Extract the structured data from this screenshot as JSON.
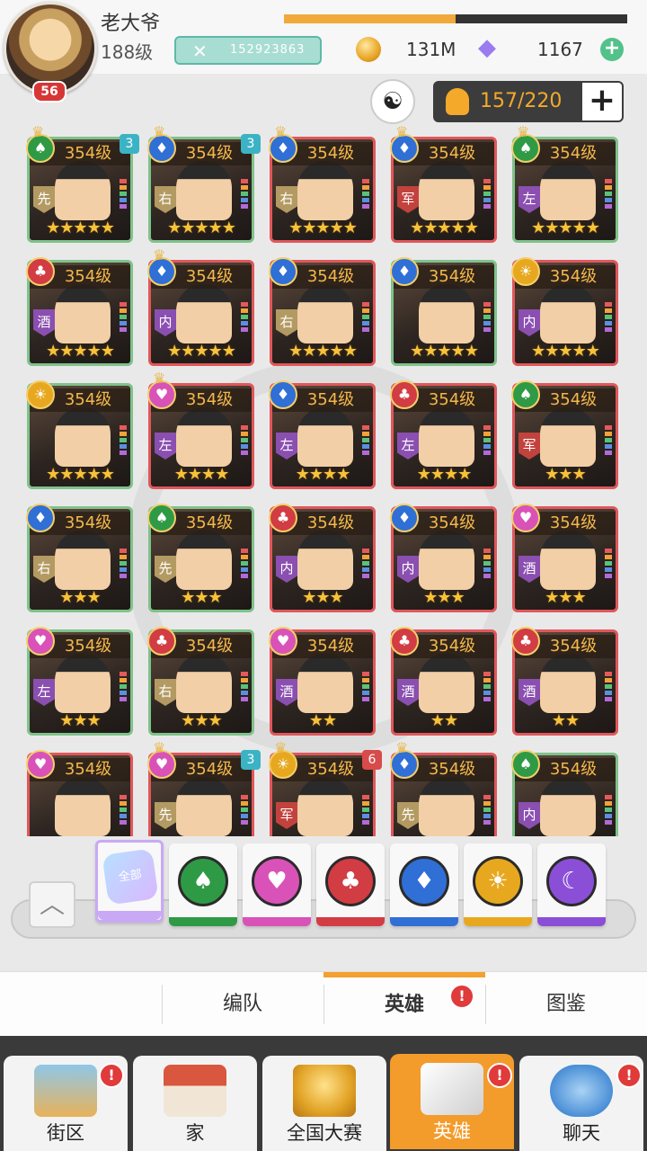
{
  "player": {
    "name": "老大爷",
    "level": "188级",
    "avatar_level": "56",
    "power": "152923863",
    "exp_progress": 0.5,
    "coins": "131M",
    "gems": "1167"
  },
  "roster": {
    "capacity": "157/220"
  },
  "heroes": [
    {
      "level": "354级",
      "suit": "spade",
      "suit_color": "green",
      "role": "先",
      "stars": "★★★★★",
      "badge": "3",
      "crown": true,
      "frame": "green"
    },
    {
      "level": "354级",
      "suit": "diamond",
      "suit_color": "blue",
      "role": "右",
      "stars": "★★★★★",
      "badge": "3",
      "crown": true,
      "frame": "green"
    },
    {
      "level": "354级",
      "suit": "diamond",
      "suit_color": "blue",
      "role": "右",
      "stars": "★★★★★",
      "badge": "",
      "crown": true,
      "frame": "red"
    },
    {
      "level": "354级",
      "suit": "diamond",
      "suit_color": "blue",
      "role": "军",
      "stars": "★★★★★",
      "badge": "",
      "crown": true,
      "frame": "red"
    },
    {
      "level": "354级",
      "suit": "spade",
      "suit_color": "green",
      "role": "左",
      "stars": "★★★★★",
      "badge": "",
      "crown": true,
      "frame": "green"
    },
    {
      "level": "354级",
      "suit": "club",
      "suit_color": "red",
      "role": "酒",
      "stars": "★★★★★",
      "badge": "",
      "crown": false,
      "frame": "green"
    },
    {
      "level": "354级",
      "suit": "diamond",
      "suit_color": "blue",
      "role": "内",
      "stars": "★★★★★",
      "badge": "",
      "crown": true,
      "frame": "red"
    },
    {
      "level": "354级",
      "suit": "diamond",
      "suit_color": "blue",
      "role": "右",
      "stars": "★★★★★",
      "badge": "",
      "crown": false,
      "frame": "red"
    },
    {
      "level": "354级",
      "suit": "diamond",
      "suit_color": "blue",
      "role": "",
      "stars": "★★★★★",
      "badge": "",
      "crown": false,
      "frame": "green"
    },
    {
      "level": "354级",
      "suit": "sun",
      "suit_color": "gold",
      "role": "内",
      "stars": "★★★★★",
      "badge": "",
      "crown": false,
      "frame": "red"
    },
    {
      "level": "354级",
      "suit": "sun",
      "suit_color": "gold",
      "role": "",
      "stars": "★★★★★",
      "badge": "",
      "crown": false,
      "frame": "green"
    },
    {
      "level": "354级",
      "suit": "heart",
      "suit_color": "pink",
      "role": "左",
      "stars": "★★★★",
      "badge": "",
      "crown": true,
      "frame": "red"
    },
    {
      "level": "354级",
      "suit": "diamond",
      "suit_color": "blue",
      "role": "左",
      "stars": "★★★★",
      "badge": "",
      "crown": false,
      "frame": "red"
    },
    {
      "level": "354级",
      "suit": "club",
      "suit_color": "red",
      "role": "左",
      "stars": "★★★★",
      "badge": "",
      "crown": false,
      "frame": "red"
    },
    {
      "level": "354级",
      "suit": "spade",
      "suit_color": "green",
      "role": "军",
      "stars": "★★★",
      "badge": "",
      "crown": false,
      "frame": "red"
    },
    {
      "level": "354级",
      "suit": "diamond",
      "suit_color": "blue",
      "role": "右",
      "stars": "★★★",
      "badge": "",
      "crown": false,
      "frame": "green"
    },
    {
      "level": "354级",
      "suit": "spade",
      "suit_color": "green",
      "role": "先",
      "stars": "★★★",
      "badge": "",
      "crown": false,
      "frame": "green"
    },
    {
      "level": "354级",
      "suit": "club",
      "suit_color": "red",
      "role": "内",
      "stars": "★★★",
      "badge": "",
      "crown": false,
      "frame": "red"
    },
    {
      "level": "354级",
      "suit": "diamond",
      "suit_color": "blue",
      "role": "内",
      "stars": "★★★",
      "badge": "",
      "crown": false,
      "frame": "red"
    },
    {
      "level": "354级",
      "suit": "heart",
      "suit_color": "pink",
      "role": "酒",
      "stars": "★★★",
      "badge": "",
      "crown": false,
      "frame": "red"
    },
    {
      "level": "354级",
      "suit": "heart",
      "suit_color": "pink",
      "role": "左",
      "stars": "★★★",
      "badge": "",
      "crown": false,
      "frame": "green"
    },
    {
      "level": "354级",
      "suit": "club",
      "suit_color": "red",
      "role": "右",
      "stars": "★★★",
      "badge": "",
      "crown": false,
      "frame": "green"
    },
    {
      "level": "354级",
      "suit": "heart",
      "suit_color": "pink",
      "role": "酒",
      "stars": "★★",
      "badge": "",
      "crown": false,
      "frame": "red"
    },
    {
      "level": "354级",
      "suit": "club",
      "suit_color": "red",
      "role": "酒",
      "stars": "★★",
      "badge": "",
      "crown": false,
      "frame": "red"
    },
    {
      "level": "354级",
      "suit": "club",
      "suit_color": "red",
      "role": "酒",
      "stars": "★★",
      "badge": "",
      "crown": false,
      "frame": "red"
    },
    {
      "level": "354级",
      "suit": "heart",
      "suit_color": "pink",
      "role": "",
      "stars": "",
      "badge": "",
      "crown": false,
      "frame": "red"
    },
    {
      "level": "354级",
      "suit": "heart",
      "suit_color": "pink",
      "role": "先",
      "stars": "",
      "badge": "3",
      "crown": true,
      "frame": "red"
    },
    {
      "level": "354级",
      "suit": "sun",
      "suit_color": "gold",
      "role": "军",
      "stars": "",
      "badge": "6",
      "crown": true,
      "frame": "red"
    },
    {
      "level": "354级",
      "suit": "diamond",
      "suit_color": "blue",
      "role": "先",
      "stars": "",
      "badge": "",
      "crown": true,
      "frame": "red"
    },
    {
      "level": "354级",
      "suit": "spade",
      "suit_color": "green",
      "role": "内",
      "stars": "",
      "badge": "",
      "crown": false,
      "frame": "green"
    }
  ],
  "filters": [
    {
      "name": "all",
      "label": "全部",
      "color": "#c9a9f5",
      "glyph": ""
    },
    {
      "name": "spade",
      "label": "",
      "color": "#2f9a45",
      "glyph": "♠"
    },
    {
      "name": "heart",
      "label": "",
      "color": "#d952b8",
      "glyph": "♥"
    },
    {
      "name": "club",
      "label": "",
      "color": "#d23c43",
      "glyph": "♣"
    },
    {
      "name": "diamond",
      "label": "",
      "color": "#2f6fd6",
      "glyph": "♦"
    },
    {
      "name": "sun",
      "label": "",
      "color": "#e7a820",
      "glyph": "☀"
    },
    {
      "name": "moon",
      "label": "",
      "color": "#8a4fd6",
      "glyph": "☾"
    }
  ],
  "subtabs": {
    "formation": "编队",
    "heroes": "英雄",
    "codex": "图鉴"
  },
  "nav": {
    "street": "街区",
    "home": "家",
    "contest": "全国大赛",
    "heroes": "英雄",
    "chat": "聊天"
  },
  "notice_mark": "!"
}
